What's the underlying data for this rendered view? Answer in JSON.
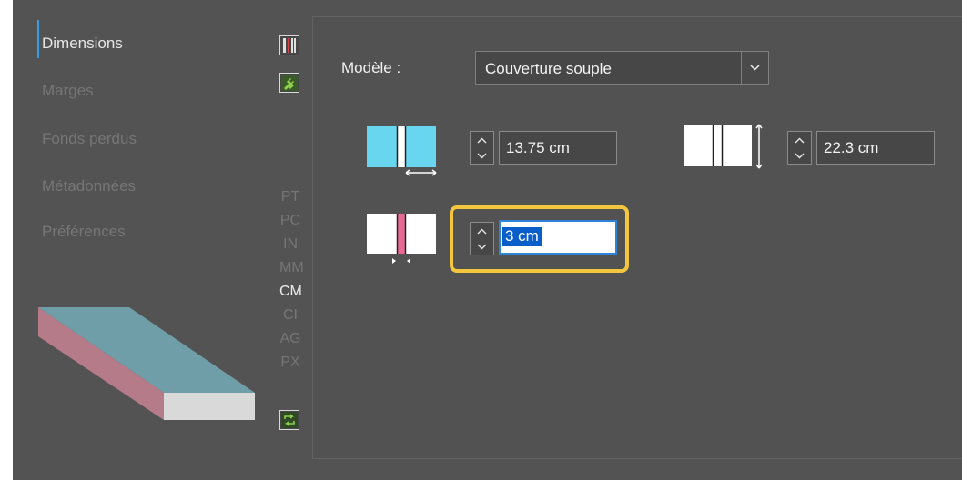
{
  "sidebar": {
    "items": [
      {
        "label": "Dimensions",
        "active": true
      },
      {
        "label": "Marges",
        "active": false
      },
      {
        "label": "Fonds perdus",
        "active": false
      },
      {
        "label": "Métadonnées",
        "active": false
      },
      {
        "label": "Préférences",
        "active": false
      }
    ]
  },
  "units": {
    "items": [
      "PT",
      "PC",
      "IN",
      "MM",
      "CM",
      "CI",
      "AG",
      "PX"
    ],
    "selected": "CM"
  },
  "model": {
    "label": "Modèle :",
    "value": "Couverture souple"
  },
  "dimensions": {
    "width": "13.75 cm",
    "height": "22.3 cm",
    "spine": "3 cm"
  },
  "colors": {
    "accent": "#3b9de0",
    "cover": "#68d6ef",
    "spine": "#e86a93",
    "highlight": "#f3c63e",
    "selection": "#0a5ec9"
  }
}
